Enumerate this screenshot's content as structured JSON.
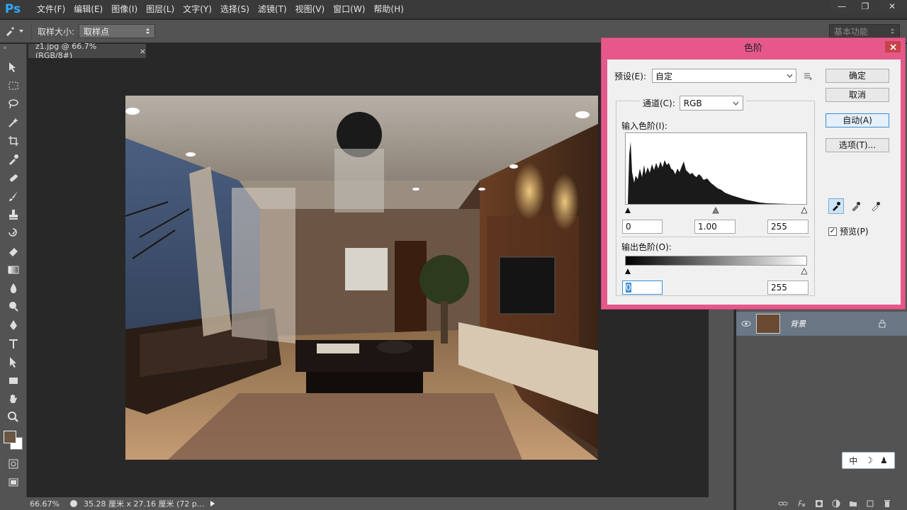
{
  "app": {
    "logo": "Ps"
  },
  "menu": [
    "文件(F)",
    "编辑(E)",
    "图像(I)",
    "图层(L)",
    "文字(Y)",
    "选择(S)",
    "滤镜(T)",
    "视图(V)",
    "窗口(W)",
    "帮助(H)"
  ],
  "window_controls": {
    "minimize": "—",
    "restore": "❐",
    "close": "✕"
  },
  "options": {
    "sample_size_label": "取样大小:",
    "sample_size_value": "取样点",
    "workspace": "基本功能"
  },
  "document": {
    "tab_title": "z1.jpg @ 66.7%(RGB/8#)",
    "tab_close": "×"
  },
  "status": {
    "zoom": "66.67%",
    "doc_size": "35.28 厘米 x 27.16 厘米 (72 p..."
  },
  "layers": {
    "layer_name": "背景"
  },
  "ime": {
    "mode": "中",
    "moon": "☽",
    "person": "♟"
  },
  "levels_dialog": {
    "title": "色阶",
    "preset_label": "预设(E):",
    "preset_value": "自定",
    "channel_label": "通道(C):",
    "channel_value": "RGB",
    "input_levels_label": "输入色阶(I):",
    "input_black": "0",
    "input_gamma": "1.00",
    "input_white": "255",
    "output_levels_label": "输出色阶(O):",
    "output_black": "0",
    "output_white": "255",
    "buttons": {
      "ok": "确定",
      "cancel": "取消",
      "auto": "自动(A)",
      "options": "选项(T)..."
    },
    "preview_label": "预览(P)",
    "preview_checked": true
  }
}
